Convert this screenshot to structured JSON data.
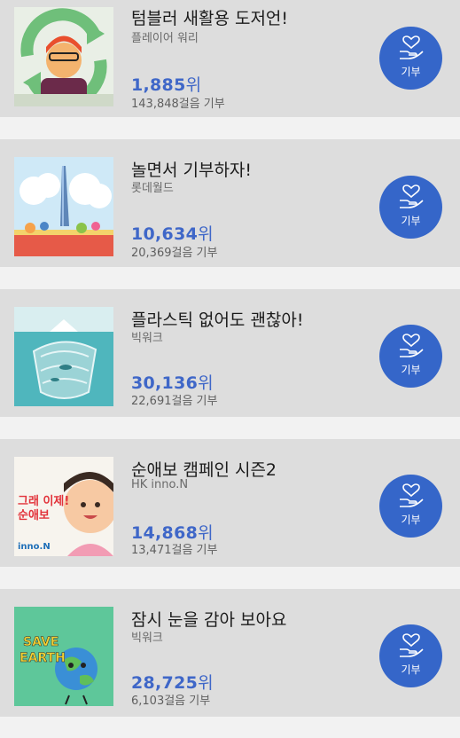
{
  "campaigns": [
    {
      "title": "텀블러 새활용 도저언!",
      "organizer": "플레이어 워리",
      "rank_number": "1,885",
      "rank_suffix": "위",
      "steps": "143,848걸음 기부",
      "donate_label": "기부"
    },
    {
      "title": "놀면서 기부하자!",
      "organizer": "롯데월드",
      "rank_number": "10,634",
      "rank_suffix": "위",
      "steps": "20,369걸음 기부",
      "donate_label": "기부"
    },
    {
      "title": "플라스틱 없어도 괜찮아!",
      "organizer": "빅워크",
      "rank_number": "30,136",
      "rank_suffix": "위",
      "steps": "22,691걸음 기부",
      "donate_label": "기부"
    },
    {
      "title": "순애보 캠페인 시즌2",
      "organizer": "HK inno.N",
      "rank_number": "14,868",
      "rank_suffix": "위",
      "steps": "13,471걸음 기부",
      "donate_label": "기부",
      "thumb_text_main": "그래 이제!\n순애보",
      "thumb_brand": "inno.N"
    },
    {
      "title": "잠시 눈을 감아 보아요",
      "organizer": "빅워크",
      "rank_number": "28,725",
      "rank_suffix": "위",
      "steps": "6,103걸음 기부",
      "donate_label": "기부",
      "thumb_text": "SAVE EARTH"
    }
  ],
  "colors": {
    "card_background": "#dddddd",
    "rank_blue": "#3f67c8",
    "donate_button": "#3566c9"
  }
}
